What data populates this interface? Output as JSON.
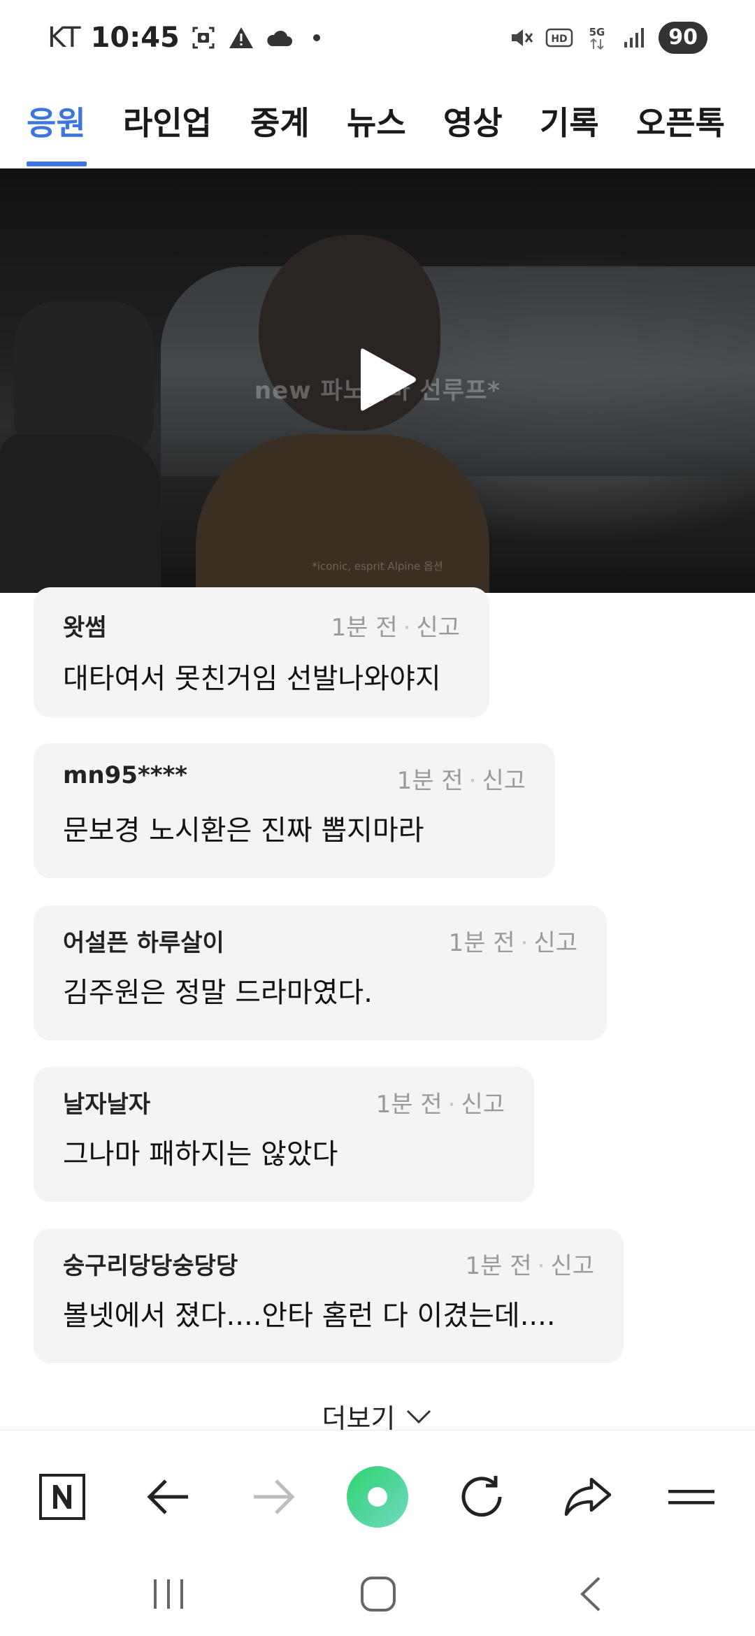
{
  "status_bar": {
    "carrier": "KT",
    "time": "10:45",
    "battery": "90",
    "icons": [
      "screenshot-icon",
      "warning-icon",
      "cloud-icon",
      "dot-icon",
      "mute-icon",
      "hd-icon",
      "5g-icon",
      "signal-icon"
    ]
  },
  "tabs": [
    {
      "label": "응원",
      "active": true
    },
    {
      "label": "라인업"
    },
    {
      "label": "중계"
    },
    {
      "label": "뉴스"
    },
    {
      "label": "영상"
    },
    {
      "label": "기록"
    },
    {
      "label": "오픈톡"
    }
  ],
  "video": {
    "overlay_text": "new 파노라마 선루프*",
    "fine_print": "*iconic, esprit Alpine 옵션",
    "play_icon": "play-icon"
  },
  "comments": [
    {
      "user": "왓썸",
      "time": "1분 전",
      "report": "신고",
      "text": "대타여서 못친거임 선발나와야지"
    },
    {
      "user": "mn95****",
      "time": "1분 전",
      "report": "신고",
      "text": "문보경 노시환은 진짜 뽑지마라"
    },
    {
      "user": "어설픈 하루살이",
      "time": "1분 전",
      "report": "신고",
      "text": "김주원은 정말 드라마였다."
    },
    {
      "user": "날자날자",
      "time": "1분 전",
      "report": "신고",
      "text": "그나마 패하지는 않았다"
    },
    {
      "user": "숭구리당당숭당당",
      "time": "1분 전",
      "report": "신고",
      "text": "볼넷에서 졌다....안타 홈런 다 이겼는데...."
    }
  ],
  "more_label": "더보기",
  "toolbar": {
    "icons": [
      "naver-home-icon",
      "back-arrow-icon",
      "forward-arrow-icon",
      "green-dot-icon",
      "refresh-icon",
      "share-icon",
      "menu-icon"
    ]
  },
  "nav_bar": {
    "icons": [
      "recents-icon",
      "home-icon",
      "back-icon"
    ]
  },
  "colors": {
    "accent": "#3d74dd",
    "bubble": "#f4f4f4",
    "meta": "#9a9a9a"
  }
}
